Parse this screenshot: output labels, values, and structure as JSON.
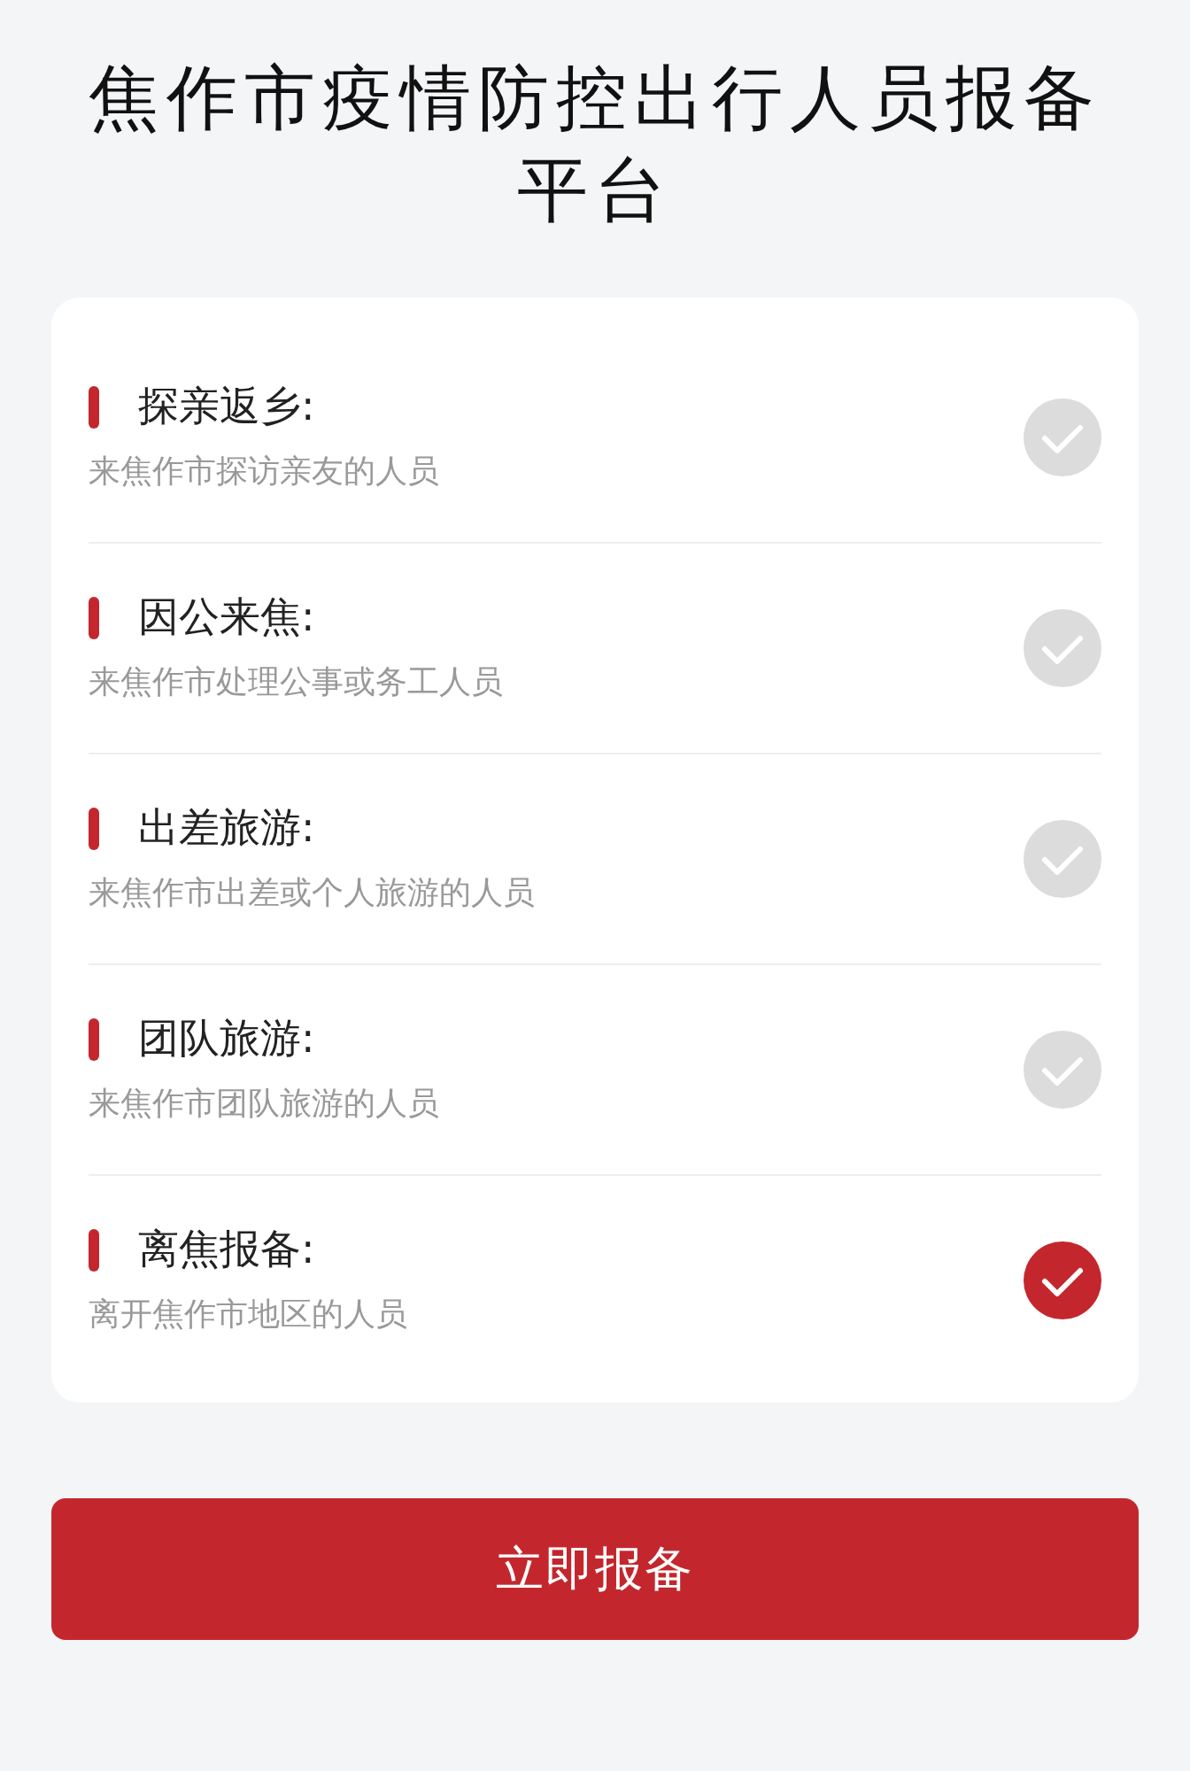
{
  "title": "焦作市疫情防控出行人员报备平台",
  "options": [
    {
      "label": "探亲返乡:",
      "description": "来焦作市探访亲友的人员",
      "selected": false
    },
    {
      "label": "因公来焦:",
      "description": "来焦作市处理公事或务工人员",
      "selected": false
    },
    {
      "label": "出差旅游:",
      "description": "来焦作市出差或个人旅游的人员",
      "selected": false
    },
    {
      "label": "团队旅游:",
      "description": "来焦作市团队旅游的人员",
      "selected": false
    },
    {
      "label": "离焦报备:",
      "description": "离开焦作市地区的人员",
      "selected": true
    }
  ],
  "submit_button": "立即报备"
}
